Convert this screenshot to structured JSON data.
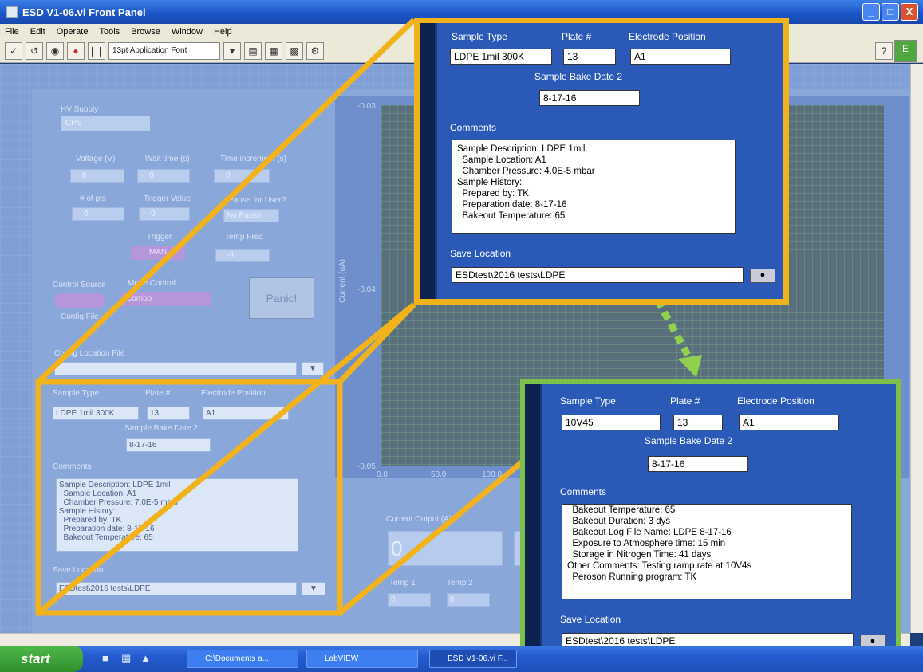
{
  "window": {
    "title": "ESD V1-06.vi Front Panel",
    "min": "_",
    "max": "□",
    "close": "X"
  },
  "menu": [
    "File",
    "Edit",
    "Operate",
    "Tools",
    "Browse",
    "Window",
    "Help"
  ],
  "toolbar": {
    "font": "13pt Application Font"
  },
  "controls": {
    "hv_supply_label": "HV Supply",
    "hv_supply_value": "CPS",
    "voltage_label": "Voltage (V)",
    "voltage_value": "0",
    "wait_label": "Wait time (s)",
    "wait_value": "0",
    "time_inc_label": "Time increment (s)",
    "time_inc_value": "0",
    "pts_label": "# of pts",
    "pts_value": "0",
    "trigger_value_label": "Trigger Value",
    "trigger_value": "0",
    "pause_label": "Pause for User?",
    "pause_value": "No Pause",
    "trigger_label": "Trigger",
    "trigger_mode": "MAN",
    "temp_freq_label": "Temp Freq",
    "temp_freq_value": "-1",
    "control_source_label": "Control Source",
    "mode_control_label": "Mode Control",
    "mode_control_value": "Combo",
    "config_label": "Config File",
    "panic": "Panic!",
    "config_location_label": "Config Location File",
    "sample_type_label": "Sample Type",
    "sample_type": "LDPE 1mil 300K",
    "plate_label": "Plate #",
    "plate": "13",
    "electrode_label": "Electrode Position",
    "electrode": "A1",
    "bake_date_label": "Sample Bake Date 2",
    "bake_date": "8-17-16",
    "comments_label": "Comments",
    "comments_text": "Sample Description: LDPE 1mil\n  Sample Location: A1\n  Chamber Pressure: 7.0E-5 mbar\nSample History:\n  Prepared by: TK\n  Preparation date: 8-17-16\n  Bakeout Temperature: 65",
    "save_location_label": "Save Location",
    "save_location": "ESDtest\\2016 tests\\LDPE",
    "current_output_label": "Current Output (A)",
    "current_output_value": "0",
    "temp1_label": "Temp 1",
    "temp1_value": "0",
    "temp2_label": "Temp 2",
    "temp2_value": "0"
  },
  "chart": {
    "ylabel": "Current (uA)",
    "yticks": [
      "-0.03",
      "-0.04",
      "-0.05"
    ],
    "xticks": [
      "0.0",
      "50.0",
      "100.0"
    ]
  },
  "zoom_top": {
    "sample_type_label": "Sample Type",
    "sample_type": "LDPE 1mil 300K",
    "plate_label": "Plate #",
    "plate": "13",
    "electrode_label": "Electrode Position",
    "electrode": "A1",
    "bake_date_label": "Sample Bake Date 2",
    "bake_date": "8-17-16",
    "comments_label": "Comments",
    "comments": "Sample Description: LDPE 1mil\n  Sample Location: A1\n  Chamber Pressure: 4.0E-5 mbar\nSample History:\n  Prepared by: TK\n  Preparation date: 8-17-16\n  Bakeout Temperature: 65",
    "save_location_label": "Save Location",
    "save_location": "ESDtest\\2016 tests\\LDPE"
  },
  "zoom_bottom": {
    "sample_type_label": "Sample Type",
    "sample_type": "10V45",
    "plate_label": "Plate #",
    "plate": "13",
    "electrode_label": "Electrode Position",
    "electrode": "A1",
    "bake_date_label": "Sample Bake Date 2",
    "bake_date": "8-17-16",
    "comments_label": "Comments",
    "comments": "  Bakeout Temperature: 65\n  Bakeout Duration: 3 dys\n  Bakeout Log File Name: LDPE 8-17-16\n  Exposure to Atmosphere time: 15 min\n  Storage in Nitrogen Time: 41 days\nOther Comments: Testing ramp rate at 10V4s\n  Peroson Running program: TK",
    "save_location_label": "Save Location",
    "save_location": "ESDtest\\2016 tests\\LDPE"
  },
  "taskbar": {
    "start": "start",
    "tasks": [
      "C:\\Documents a...",
      "LabVIEW",
      "ESD V1-06.vi F..."
    ]
  },
  "colors": {
    "callout_border_yellow": "#f2b21c",
    "callout_border_green": "#7cc04a",
    "arrow": "#8fd14f"
  }
}
